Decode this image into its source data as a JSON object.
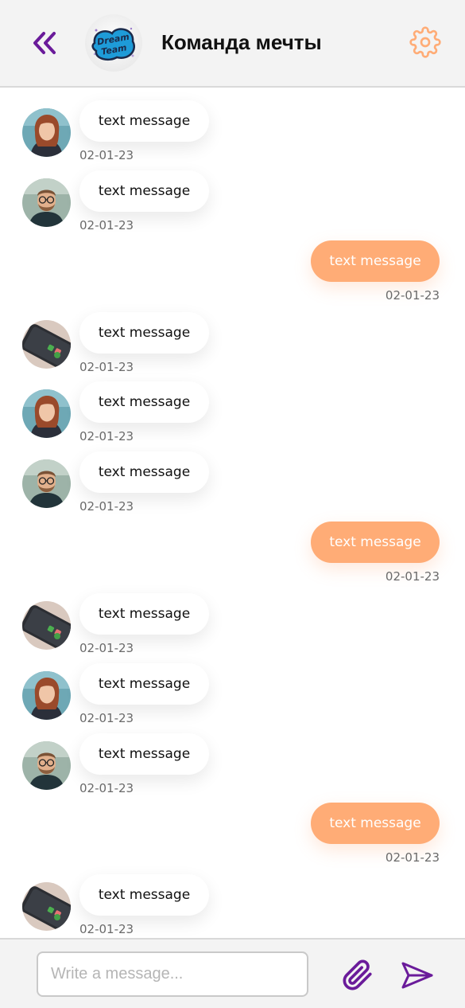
{
  "header": {
    "title": "Команда мечты",
    "logo_text_1": "Dream",
    "logo_text_2": "Team",
    "accent_back": "#6a1b9a",
    "accent_settings": "#ffac76"
  },
  "messages": [
    {
      "direction": "in",
      "sender": "woman",
      "text": "text message",
      "time": "02-01-23"
    },
    {
      "direction": "in",
      "sender": "man",
      "text": "text message",
      "time": "02-01-23"
    },
    {
      "direction": "out",
      "text": "text message",
      "time": "02-01-23"
    },
    {
      "direction": "in",
      "sender": "phone",
      "text": "text message",
      "time": "02-01-23"
    },
    {
      "direction": "in",
      "sender": "woman",
      "text": "text message",
      "time": "02-01-23"
    },
    {
      "direction": "in",
      "sender": "man",
      "text": "text message",
      "time": "02-01-23"
    },
    {
      "direction": "out",
      "text": "text message",
      "time": "02-01-23"
    },
    {
      "direction": "in",
      "sender": "phone",
      "text": "text message",
      "time": "02-01-23"
    },
    {
      "direction": "in",
      "sender": "woman",
      "text": "text message",
      "time": "02-01-23"
    },
    {
      "direction": "in",
      "sender": "man",
      "text": "text message",
      "time": "02-01-23"
    },
    {
      "direction": "out",
      "text": "text message",
      "time": "02-01-23"
    },
    {
      "direction": "in",
      "sender": "phone",
      "text": "text message",
      "time": "02-01-23"
    }
  ],
  "composer": {
    "placeholder": "Write a message...",
    "value": ""
  },
  "icons": {
    "back": "chevrons-left-icon",
    "settings": "gear-icon",
    "attach": "paperclip-icon",
    "send": "send-icon"
  },
  "colors": {
    "outgoing_bubble": "#ffac76",
    "incoming_bubble": "#ffffff",
    "icon_purple": "#6a1b9a"
  }
}
